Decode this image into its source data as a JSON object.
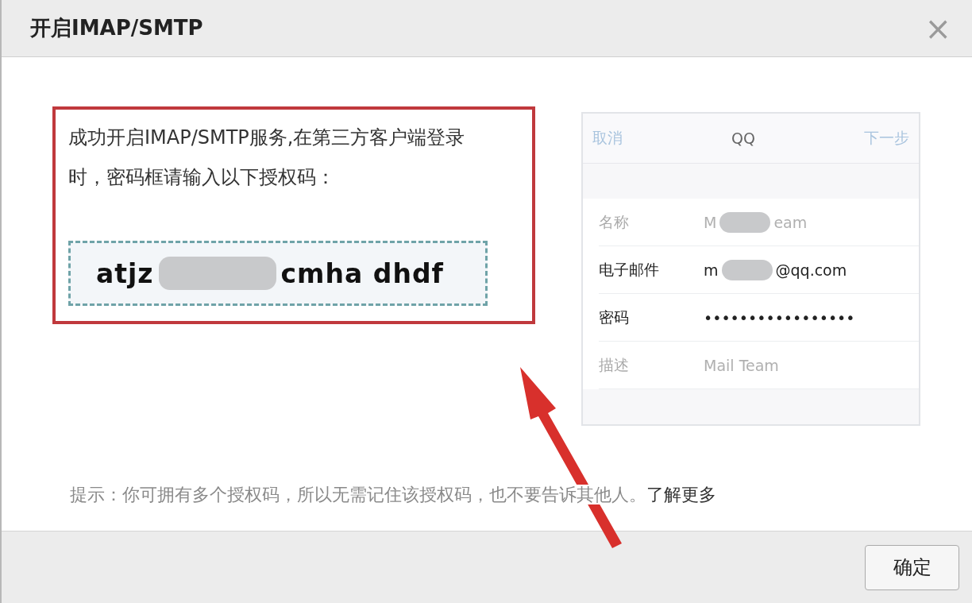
{
  "dialog": {
    "title": "开启IMAP/SMTP",
    "close": "×"
  },
  "message": "成功开启IMAP/SMTP服务,在第三方客户端登录时，密码框请输入以下授权码：",
  "auth_code": {
    "parts": [
      "atjz",
      "cmha dhdf"
    ]
  },
  "phone": {
    "cancel": "取消",
    "title": "QQ",
    "next": "下一步",
    "rows": [
      {
        "label": "名称",
        "parts": [
          "M",
          "eam"
        ],
        "emphasis": false
      },
      {
        "label": "电子邮件",
        "parts": [
          "m",
          "@qq.com"
        ],
        "emphasis": true
      },
      {
        "label": "密码",
        "parts": [
          "•••••••••••••••••"
        ],
        "emphasis": true
      },
      {
        "label": "描述",
        "parts": [
          "Mail Team"
        ],
        "emphasis": false
      }
    ]
  },
  "hint": {
    "text": "提示：你可拥有多个授权码，所以无需记住该授权码，也不要告诉其他人。",
    "link": "了解更多"
  },
  "buttons": [
    "确定"
  ]
}
